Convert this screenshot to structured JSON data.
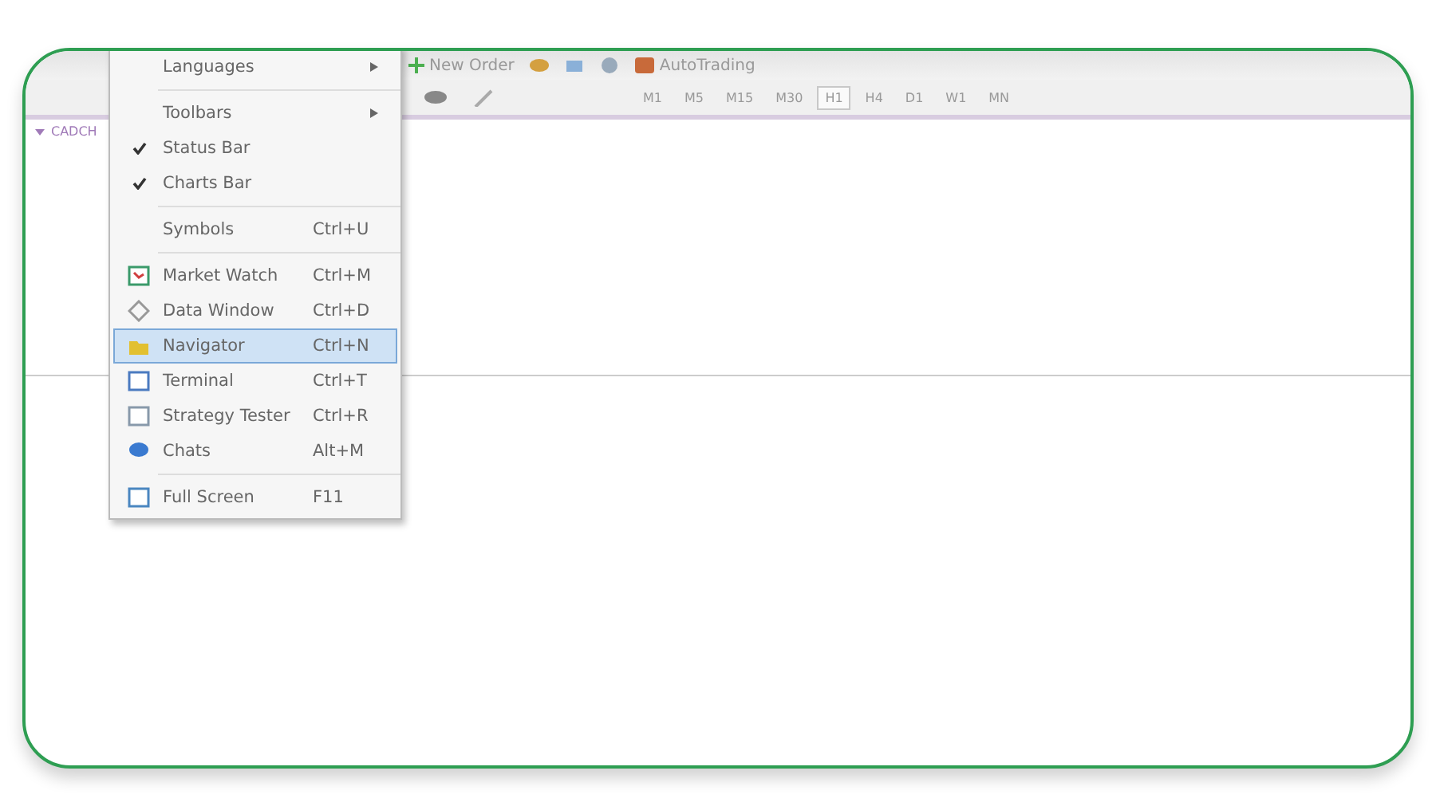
{
  "toolbar": {
    "new_order": "New Order",
    "auto_trading": "AutoTrading",
    "timeframes": [
      {
        "label": "M1",
        "selected": false
      },
      {
        "label": "M5",
        "selected": false
      },
      {
        "label": "M15",
        "selected": false
      },
      {
        "label": "M30",
        "selected": false
      },
      {
        "label": "H1",
        "selected": true
      },
      {
        "label": "H4",
        "selected": false
      },
      {
        "label": "D1",
        "selected": false
      },
      {
        "label": "W1",
        "selected": false
      },
      {
        "label": "MN",
        "selected": false
      }
    ]
  },
  "chart_tab": {
    "label": "CADCH"
  },
  "view_menu": {
    "items": [
      {
        "kind": "submenu",
        "label": "Languages"
      },
      {
        "kind": "separator"
      },
      {
        "kind": "submenu",
        "label": "Toolbars"
      },
      {
        "kind": "check",
        "label": "Status Bar",
        "checked": true
      },
      {
        "kind": "check",
        "label": "Charts Bar",
        "checked": true
      },
      {
        "kind": "separator"
      },
      {
        "kind": "item",
        "label": "Symbols",
        "shortcut": "Ctrl+U",
        "selected": false
      },
      {
        "kind": "separator"
      },
      {
        "kind": "item",
        "label": "Market Watch",
        "shortcut": "Ctrl+M",
        "selected": false
      },
      {
        "kind": "item",
        "label": "Data Window",
        "shortcut": "Ctrl+D",
        "selected": false
      },
      {
        "kind": "item",
        "label": "Navigator",
        "shortcut": "Ctrl+N",
        "selected": true
      },
      {
        "kind": "item",
        "label": "Terminal",
        "shortcut": "Ctrl+T",
        "selected": false
      },
      {
        "kind": "item",
        "label": "Strategy Tester",
        "shortcut": "Ctrl+R",
        "selected": false
      },
      {
        "kind": "item",
        "label": "Chats",
        "shortcut": "Alt+M",
        "selected": false
      },
      {
        "kind": "separator"
      },
      {
        "kind": "item",
        "label": "Full Screen",
        "shortcut": "F11",
        "selected": false
      }
    ]
  }
}
